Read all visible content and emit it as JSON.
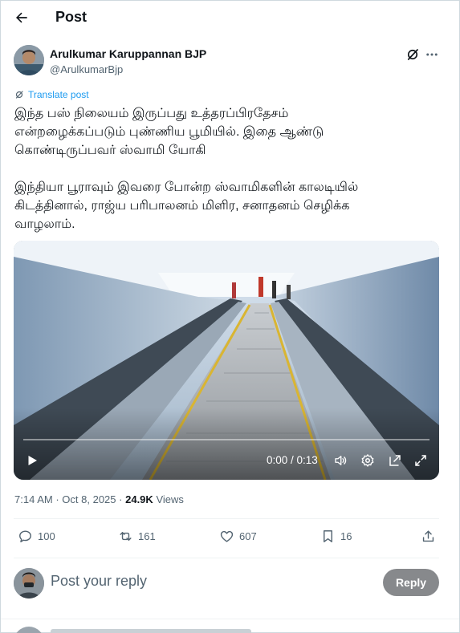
{
  "header": {
    "title": "Post"
  },
  "author": {
    "name": "Arulkumar Karuppannan BJP",
    "handle": "@ArulkumarBjp"
  },
  "translate": {
    "label": "Translate post"
  },
  "post": {
    "lines": [
      "இந்த பஸ் நிலையம் இருப்பது உத்தரப்பிரதேசம்",
      "என்றழைக்கப்படும் புண்ணிய பூமியில். இதை ஆண்டு",
      "கொண்டிருப்பவர் ஸ்வாமி யோகி"
    ],
    "lines2": [
      "இந்தியா பூராவும் இவரை போன்ற ஸ்வாமிகளின் காலடியில்",
      "கிடத்தினால், ராஜ்ய பரிபாலனம் மிளிர, சனாதனம் செழிக்க",
      "வாழலாம்."
    ]
  },
  "video": {
    "time": "0:00 / 0:13",
    "progress": 0
  },
  "meta": {
    "time": "7:14 AM",
    "separator": "·",
    "date": "Oct 8, 2025",
    "views_count": "24.9K",
    "views_label": "Views"
  },
  "actions": {
    "replies": "100",
    "reposts": "161",
    "likes": "607",
    "bookmarks": "16"
  },
  "reply": {
    "placeholder": "Post your reply",
    "button_label": "Reply"
  },
  "colors": {
    "accent": "#1d9bf0",
    "secondary_text": "#536471",
    "reply_button": "#87898c"
  }
}
